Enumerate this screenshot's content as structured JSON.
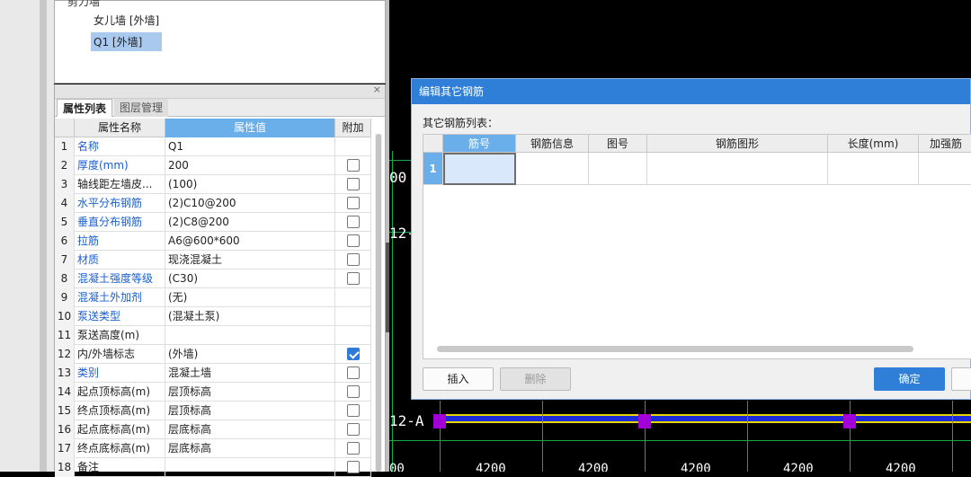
{
  "tree": {
    "cut_label": "剪力墙",
    "items": [
      "女儿墙 [外墙]",
      "Q1 [外墙]"
    ]
  },
  "props_panel": {
    "close_glyph": "×",
    "tabs": [
      "属性列表",
      "图层管理"
    ],
    "headers": [
      "属性名称",
      "属性值",
      "附加"
    ],
    "rows": [
      {
        "num": "1",
        "name": "名称",
        "value": "Q1",
        "blue": true,
        "check": null
      },
      {
        "num": "2",
        "name": "厚度(mm)",
        "value": "200",
        "blue": true,
        "check": false
      },
      {
        "num": "3",
        "name": "轴线距左墙皮...",
        "value": "(100)",
        "blue": false,
        "check": false
      },
      {
        "num": "4",
        "name": "水平分布钢筋",
        "value": "(2)C10@200",
        "blue": true,
        "check": false
      },
      {
        "num": "5",
        "name": "垂直分布钢筋",
        "value": "(2)C8@200",
        "blue": true,
        "check": false
      },
      {
        "num": "6",
        "name": "拉筋",
        "value": "A6@600*600",
        "blue": true,
        "check": false
      },
      {
        "num": "7",
        "name": "材质",
        "value": "现浇混凝土",
        "blue": true,
        "check": false
      },
      {
        "num": "8",
        "name": "混凝土强度等级",
        "value": "(C30)",
        "blue": true,
        "check": false
      },
      {
        "num": "9",
        "name": "混凝土外加剂",
        "value": "(无)",
        "blue": true,
        "check": null
      },
      {
        "num": "10",
        "name": "泵送类型",
        "value": "(混凝土泵)",
        "blue": true,
        "check": null
      },
      {
        "num": "11",
        "name": "泵送高度(m)",
        "value": "",
        "blue": false,
        "check": null
      },
      {
        "num": "12",
        "name": "内/外墙标志",
        "value": "(外墙)",
        "blue": false,
        "check": true
      },
      {
        "num": "13",
        "name": "类别",
        "value": "混凝土墙",
        "blue": true,
        "check": false
      },
      {
        "num": "14",
        "name": "起点顶标高(m)",
        "value": "层顶标高",
        "blue": false,
        "check": false
      },
      {
        "num": "15",
        "name": "终点顶标高(m)",
        "value": "层顶标高",
        "blue": false,
        "check": false
      },
      {
        "num": "16",
        "name": "起点底标高(m)",
        "value": "层底标高",
        "blue": false,
        "check": false
      },
      {
        "num": "17",
        "name": "终点底标高(m)",
        "value": "层底标高",
        "blue": false,
        "check": false
      },
      {
        "num": "18",
        "name": "备注",
        "value": "",
        "blue": false,
        "check": false
      }
    ]
  },
  "cad": {
    "labels": [
      "00",
      "12-",
      "12-A",
      "00",
      "4200",
      "4200",
      "4200",
      "4200",
      "4200"
    ]
  },
  "dialog": {
    "title": "编辑其它钢筋",
    "list_label": "其它钢筋列表：",
    "columns": [
      "筋号",
      "钢筋信息",
      "图号",
      "钢筋图形",
      "长度(mm)",
      "加强筋"
    ],
    "row_num": "1",
    "insert": "插入",
    "delete": "删除",
    "ok": "确定"
  }
}
